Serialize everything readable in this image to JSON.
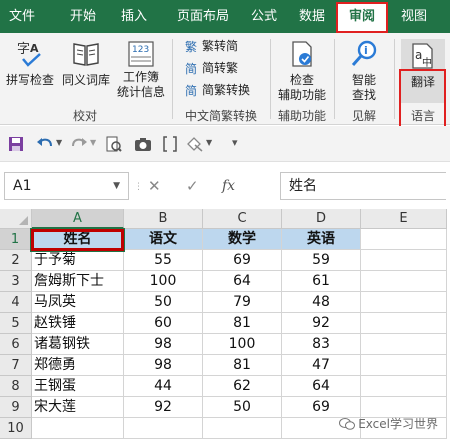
{
  "tabs": [
    {
      "label": "文件",
      "active": false
    },
    {
      "label": "开始",
      "active": false
    },
    {
      "label": "插入",
      "active": false
    },
    {
      "label": "页面布局",
      "active": false
    },
    {
      "label": "公式",
      "active": false
    },
    {
      "label": "数据",
      "active": false
    },
    {
      "label": "审阅",
      "active": true
    },
    {
      "label": "视图",
      "active": false
    }
  ],
  "ribbon": {
    "proofing": {
      "spell_check": "拼写检查",
      "thesaurus": "同义词库",
      "workbook_stats_1": "工作簿",
      "workbook_stats_2": "统计信息",
      "group_label": "校对"
    },
    "chinese": {
      "t2s": "繁转简",
      "s2t": "简转繁",
      "convert": "简繁转换",
      "group_label": "中文简繁转换"
    },
    "accessibility": {
      "check_1": "检查",
      "check_2": "辅助功能",
      "group_label": "辅助功能"
    },
    "insights": {
      "smart_1": "智能",
      "smart_2": "查找",
      "group_label": "见解"
    },
    "language": {
      "translate": "翻译",
      "group_label": "语言"
    }
  },
  "formula_bar": {
    "name_box": "A1",
    "fx": "fx",
    "formula": "姓名"
  },
  "grid": {
    "columns": [
      "A",
      "B",
      "C",
      "D",
      "E"
    ],
    "rows": [
      "1",
      "2",
      "3",
      "4",
      "5",
      "6",
      "7",
      "8",
      "9",
      "10"
    ],
    "header_row": [
      "姓名",
      "语文",
      "数学",
      "英语"
    ],
    "data": [
      [
        "于予菊",
        "55",
        "69",
        "59"
      ],
      [
        "詹姆斯下士",
        "100",
        "64",
        "61"
      ],
      [
        "马凤英",
        "50",
        "79",
        "48"
      ],
      [
        "赵铁锤",
        "60",
        "81",
        "92"
      ],
      [
        "诸葛钢铁",
        "98",
        "100",
        "83"
      ],
      [
        "郑德勇",
        "98",
        "81",
        "47"
      ],
      [
        "王钢蛋",
        "44",
        "62",
        "64"
      ],
      [
        "宋大莲",
        "92",
        "50",
        "69"
      ]
    ]
  },
  "watermark": "Excel学习世界",
  "colors": {
    "excel_green": "#217346",
    "highlight_red": "#e02020",
    "header_fill": "#bdd7ee"
  }
}
